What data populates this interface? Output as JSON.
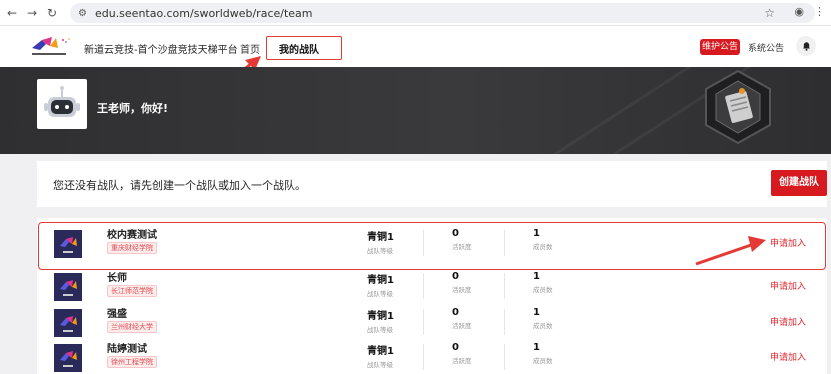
{
  "browser": {
    "url": "edu.seentao.com/sworldweb/race/team",
    "icons": [
      "back-icon",
      "forward-icon",
      "reload-icon",
      "site-settings-icon",
      "bookmark-star-icon",
      "profile-icon",
      "menu-dots-icon"
    ]
  },
  "header": {
    "site_title": "新道云竞技-首个沙盘竞技天梯平台",
    "nav": {
      "home": "首页",
      "my_team": "我的战队"
    },
    "maintenance": "维护公告",
    "system_notice": "系统公告"
  },
  "banner": {
    "greeting": "王老师，你好!"
  },
  "notice": {
    "text": "您还没有战队，请先创建一个战队或加入一个战队。",
    "create_button": "创建战队"
  },
  "labels": {
    "level": "战队等级",
    "activity": "活跃度",
    "members": "成员数",
    "apply": "申请加入"
  },
  "teams": [
    {
      "name": "校内赛测试",
      "school": "重庆财经学院",
      "level": "青铜1",
      "activity": "0",
      "members": "1"
    },
    {
      "name": "长师",
      "school": "长江师范学院",
      "level": "青铜1",
      "activity": "0",
      "members": "1"
    },
    {
      "name": "强盛",
      "school": "兰州财经大学",
      "level": "青铜1",
      "activity": "0",
      "members": "1"
    },
    {
      "name": "陆婷测试",
      "school": "徐州工程学院",
      "level": "青铜1",
      "activity": "0",
      "members": "1"
    }
  ],
  "colors": {
    "brand_red": "#d71920",
    "banner_dark": "#333335",
    "annotation_red": "#e53935"
  }
}
